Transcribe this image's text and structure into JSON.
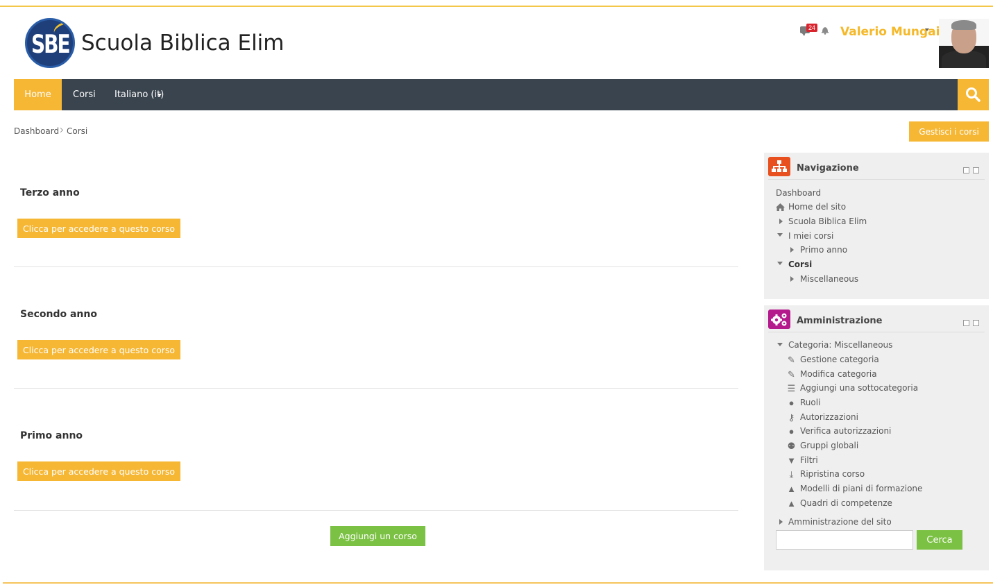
{
  "colors": {
    "accent": "#f6b735",
    "navbar": "#3a444e",
    "green": "#7bc143",
    "nav_icon": "#e8501f",
    "admin_icon": "#b41a8c"
  },
  "header": {
    "site_name": "Scuola Biblica Elim",
    "logo_text": "SBE",
    "messages_count": "24",
    "user_name": "Valerio Mungai"
  },
  "navbar": {
    "home": "Home",
    "corsi": "Corsi",
    "language": "Italiano (it)"
  },
  "breadcrumb": {
    "dashboard": "Dashboard",
    "corsi": "Corsi"
  },
  "manage_button": "Gestisci i corsi",
  "courses": [
    {
      "title": "Terzo anno",
      "button": "Clicca per accedere a questo corso"
    },
    {
      "title": "Secondo anno",
      "button": "Clicca per accedere a questo corso"
    },
    {
      "title": "Primo anno",
      "button": "Clicca per accedere a questo corso"
    }
  ],
  "add_course_button": "Aggiungi un corso",
  "navigation_block": {
    "title": "Navigazione",
    "items": [
      "Dashboard",
      "Home del sito",
      "Scuola Biblica Elim",
      "I miei corsi",
      "Primo anno",
      "Corsi",
      "Miscellaneous"
    ]
  },
  "admin_block": {
    "title": "Amministrazione",
    "category": "Categoria: Miscellaneous",
    "items": [
      {
        "label": "Gestione categoria",
        "icon": "pencil-icon"
      },
      {
        "label": "Modifica categoria",
        "icon": "pencil-icon"
      },
      {
        "label": "Aggiungi una sottocategoria",
        "icon": "subcategory-icon"
      },
      {
        "label": "Ruoli",
        "icon": "user-icon"
      },
      {
        "label": "Autorizzazioni",
        "icon": "key-icon"
      },
      {
        "label": "Verifica autorizzazioni",
        "icon": "user-check-icon"
      },
      {
        "label": "Gruppi globali",
        "icon": "users-icon"
      },
      {
        "label": "Filtri",
        "icon": "filter-icon"
      },
      {
        "label": "Ripristina corso",
        "icon": "restore-icon"
      },
      {
        "label": "Modelli di piani di formazione",
        "icon": "competency-icon"
      },
      {
        "label": "Quadri di competenze",
        "icon": "competency-icon"
      }
    ],
    "site_admin": "Amministrazione del sito",
    "search_button": "Cerca"
  }
}
